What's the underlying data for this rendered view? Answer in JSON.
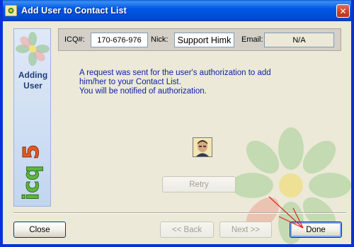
{
  "window": {
    "title": "Add User to Contact List",
    "close_glyph": "✕"
  },
  "side_panel": {
    "label_line1": "Adding",
    "label_line2": "User",
    "logo_text": "icq5"
  },
  "info": {
    "icq_label": "ICQ#:",
    "icq_value": "170-676-976",
    "nick_label": "Nick:",
    "nick_value": "Support Himk",
    "email_label": "Email:",
    "email_value": "N/A"
  },
  "message": "A request was sent for the user's authorization to add\nhim/her to your Contact List.\nYou will be notified of authorization.",
  "buttons": {
    "retry": "Retry",
    "close": "Close",
    "back": "<< Back",
    "next": "Next >>",
    "done": "Done"
  },
  "colors": {
    "titlebar": "#0058e6",
    "message_text": "#0b1fa3",
    "annotation_arrow": "#e02020"
  }
}
